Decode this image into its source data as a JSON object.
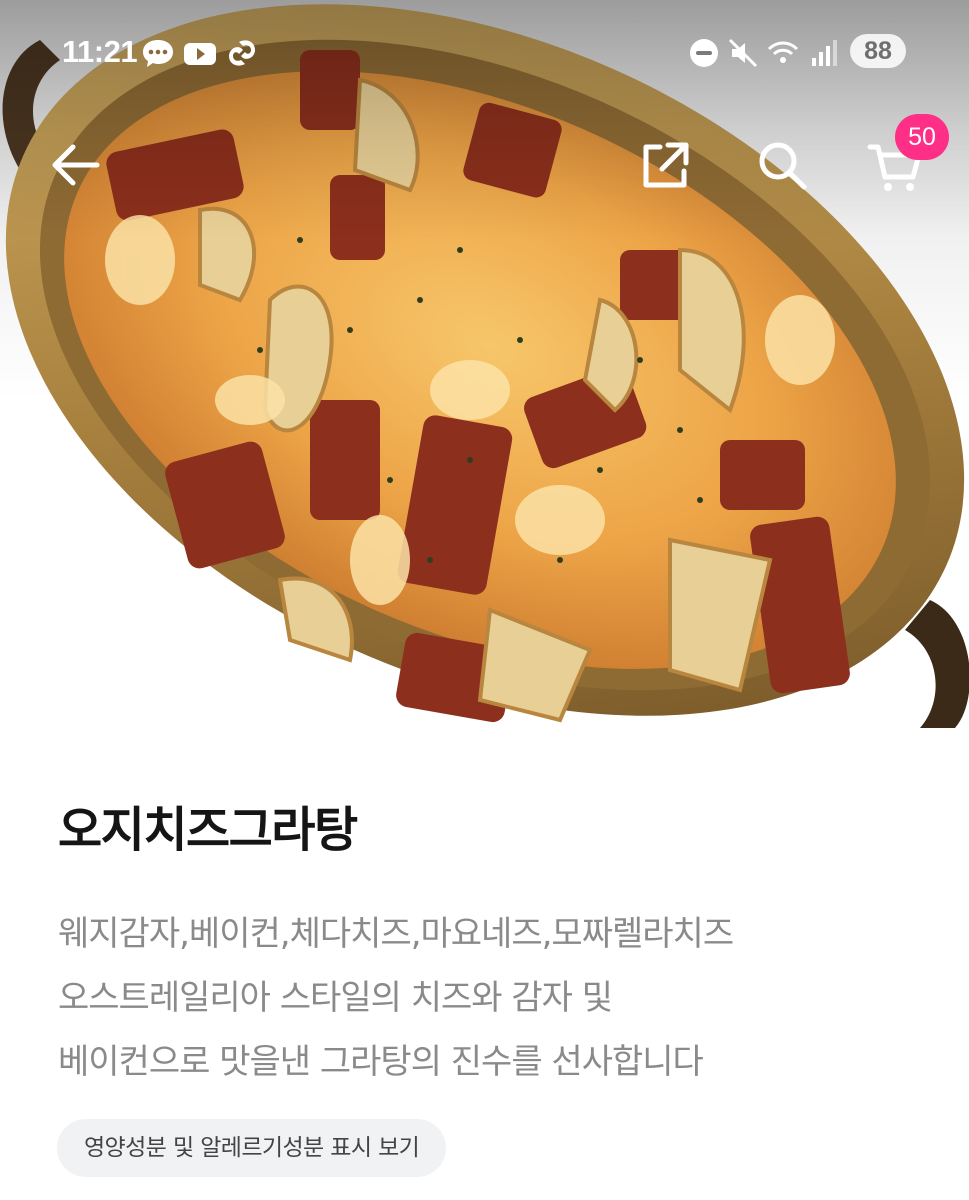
{
  "status_bar": {
    "time": "11:21",
    "battery": "88",
    "left_icons": [
      "message-icon",
      "youtube-icon",
      "link-icon"
    ],
    "right_icons": [
      "do-not-disturb-icon",
      "mute-icon",
      "wifi-icon",
      "signal-icon"
    ]
  },
  "nav": {
    "back_icon": "back-arrow-icon",
    "share_icon": "share-icon",
    "search_icon": "search-icon",
    "cart_icon": "cart-icon",
    "cart_count": "50",
    "badge_color": "#ff2f87"
  },
  "product": {
    "image": "gratin-dish-photo",
    "name": "오지치즈그라탕",
    "description_lines": [
      "웨지감자,베이컨,체다치즈,마요네즈,모짜렐라치즈",
      "오스트레일리아 스타일의 치즈와 감자 및",
      "베이컨으로 맛을낸 그라탕의 진수를 선사합니다"
    ],
    "nutrition_button": "영양성분 및 알레르기성분 표시 보기"
  }
}
